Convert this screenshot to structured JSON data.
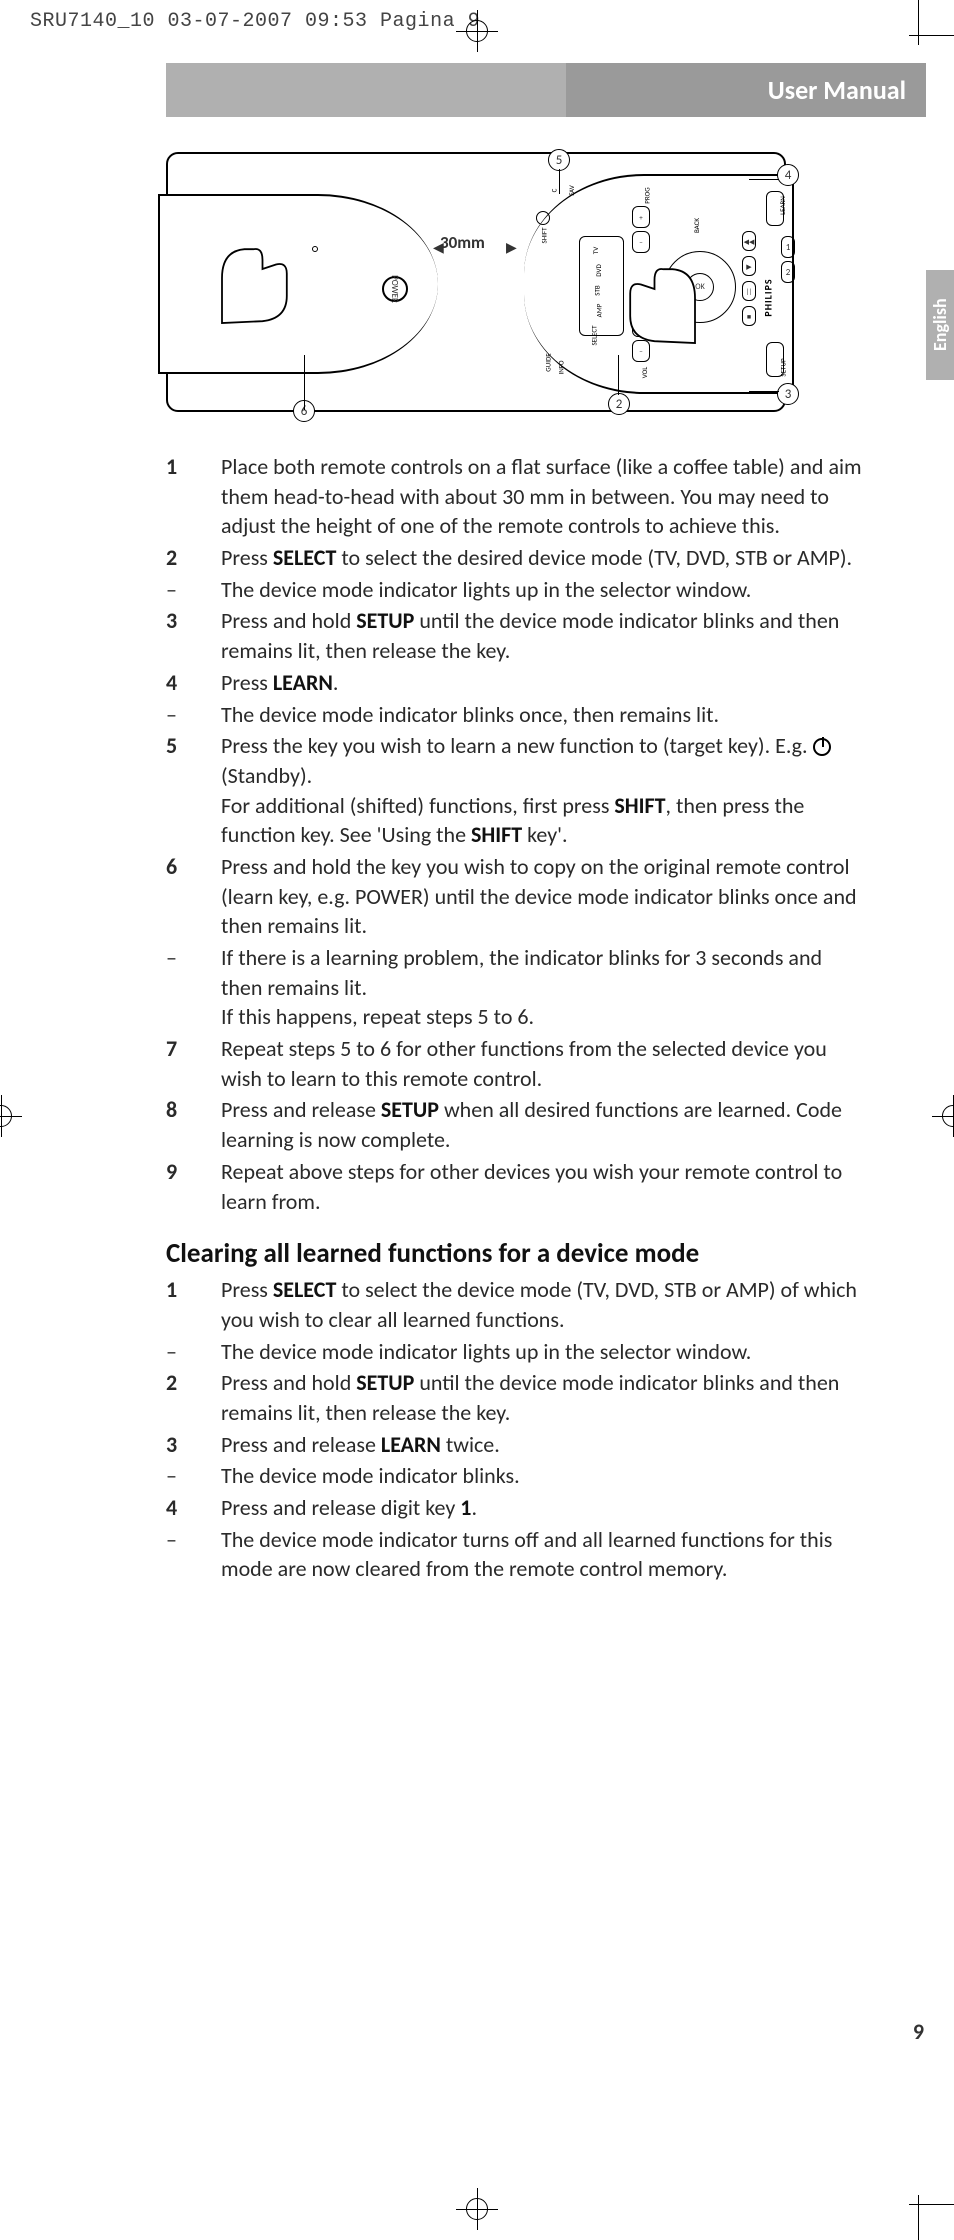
{
  "printHeader": "SRU7140_10  03-07-2007  09:53  Pagina 9",
  "header": {
    "title": "User Manual"
  },
  "language": "English",
  "figure": {
    "distance": "30mm",
    "brand": "PHILIPS",
    "leftPower": "POWER",
    "labels": {
      "shift": "SHIFT",
      "guide": "GUIDE",
      "info": "INFO",
      "c2": "C",
      "fav": "FAV",
      "tv": "TV",
      "dvd": "DVD",
      "stb": "STB",
      "amp": "AMP",
      "select": "SELECT",
      "vol": "VOL",
      "prog": "PROG",
      "plus": "+",
      "minus": "−",
      "ok": "OK",
      "back": "BACK",
      "learn": "LEARN",
      "setup": "SETUP"
    },
    "callouts": {
      "c2": "2",
      "c3": "3",
      "c4": "4",
      "c5": "5",
      "c6": "6"
    }
  },
  "steps": [
    {
      "n": "1",
      "html": "Place both remote controls on a flat surface (like a coffee table) and aim them head-to-head with about 30 mm in between. You may need to adjust the height of one of the remote controls to achieve this."
    },
    {
      "n": "2",
      "html": "Press <b>SELECT</b> to select the desired device mode (TV, DVD, STB or AMP)."
    },
    {
      "d": "–",
      "html": "The device mode indicator lights up in the selector window."
    },
    {
      "n": "3",
      "html": "Press and hold <b>SETUP</b> until the device mode indicator blinks and then remains lit, then release the key."
    },
    {
      "n": "4",
      "html": "Press <b>LEARN</b>."
    },
    {
      "d": "–",
      "html": "The device mode indicator blinks once, then remains lit."
    },
    {
      "n": "5",
      "html": "Press the key you wish to learn a new function to (target key). E.g.  <span class='power-icon' data-name='standby-icon' data-interactable='false'></span> (Standby).<br>For additional (shifted) functions, first press <b>SHIFT</b>, then press the function key. See 'Using the <b>SHIFT</b> key'."
    },
    {
      "n": "6",
      "html": "Press and hold the key you wish to copy on the original remote control (learn key, e.g. POWER) until the device mode indicator blinks once and then remains lit."
    },
    {
      "d": "–",
      "html": "If there is a learning problem, the indicator blinks for 3 seconds and then remains lit.<br>If this happens, repeat steps 5 to 6."
    },
    {
      "n": "7",
      "html": "Repeat steps 5 to 6 for other functions from the selected device you wish to learn to this remote control."
    },
    {
      "n": "8",
      "html": "Press and release <b>SETUP</b> when all desired functions are learned. Code learning is now complete."
    },
    {
      "n": "9",
      "html": "Repeat above steps for other devices you wish your remote control to learn from."
    }
  ],
  "heading2": "Clearing all learned functions for a device mode",
  "steps2": [
    {
      "n": "1",
      "html": "Press <b>SELECT</b> to select the device mode (TV, DVD, STB or AMP) of which you wish to clear all learned functions."
    },
    {
      "d": "–",
      "html": "The device mode indicator lights up in the selector window."
    },
    {
      "n": "2",
      "html": "Press and hold <b>SETUP</b> until the device mode indicator blinks and then remains lit, then release the key."
    },
    {
      "n": "3",
      "html": "Press and release <b>LEARN</b> twice."
    },
    {
      "d": "–",
      "html": "The device mode indicator blinks."
    },
    {
      "n": "4",
      "html": "Press and release digit key <b>1</b>."
    },
    {
      "d": "–",
      "html": "The device mode indicator turns off and all learned functions for this mode are now cleared from the remote control memory."
    }
  ],
  "pageNumber": "9"
}
